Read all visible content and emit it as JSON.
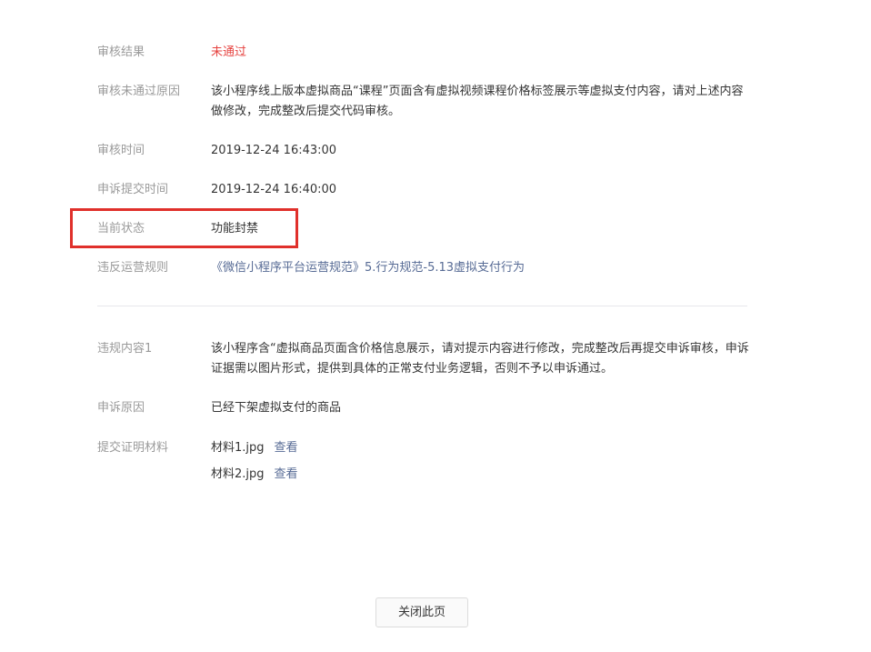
{
  "review": {
    "result_label": "审核结果",
    "result_value": "未通过",
    "reason_label": "审核未通过原因",
    "reason_value": "该小程序线上版本虚拟商品“课程”页面含有虚拟视频课程价格标签展示等虚拟支付内容，请对上述内容做修改，完成整改后提交代码审核。",
    "time_label": "审核时间",
    "time_value": "2019-12-24 16:43:00",
    "appeal_time_label": "申诉提交时间",
    "appeal_time_value": "2019-12-24 16:40:00",
    "status_label": "当前状态",
    "status_value": "功能封禁",
    "rule_label": "违反运营规则",
    "rule_value": "《微信小程序平台运营规范》5.行为规范-5.13虚拟支付行为"
  },
  "appeal": {
    "violation_label": "违规内容1",
    "violation_value": "该小程序含“虚拟商品页面含价格信息展示，请对提示内容进行修改，完成整改后再提交申诉审核，申诉证据需以图片形式，提供到具体的正常支付业务逻辑，否则不予以申诉通过。",
    "reason_label": "申诉原因",
    "reason_value": "已经下架虚拟支付的商品",
    "materials_label": "提交证明材料",
    "materials": [
      {
        "name": "材料1.jpg",
        "view_label": "查看"
      },
      {
        "name": "材料2.jpg",
        "view_label": "查看"
      }
    ]
  },
  "footer": {
    "close_label": "关闭此页"
  },
  "colors": {
    "fail": "#e64340",
    "link": "#576b95",
    "highlight": "#e0302b"
  }
}
